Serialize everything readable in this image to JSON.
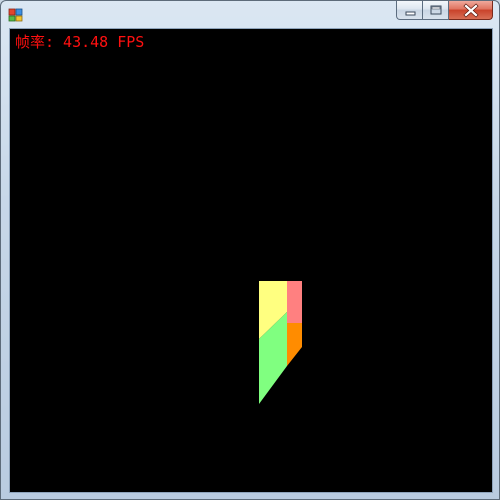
{
  "window": {
    "title": "",
    "controls": {
      "minimize_icon": "minimize-icon",
      "maximize_icon": "maximize-icon",
      "close_icon": "close-icon"
    }
  },
  "overlay": {
    "fps_text": "帧率: 43.48 FPS",
    "fps_color": "#ff1010"
  },
  "scene": {
    "background": "#000000",
    "face_colors": {
      "top_left": "#ffff80",
      "top_right": "#ff8080",
      "bottom_left": "#80ff80",
      "bottom_right": "#ff8c00"
    }
  }
}
